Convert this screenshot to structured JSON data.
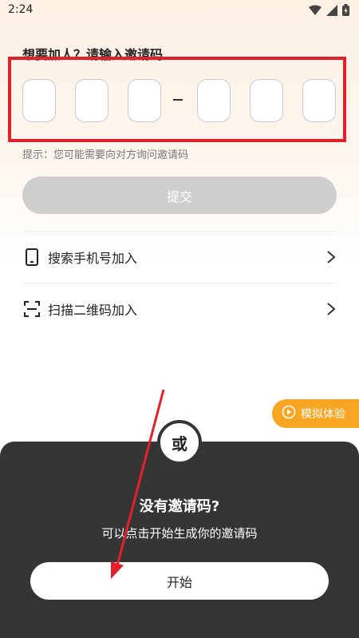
{
  "status_bar": {
    "time": "2:24",
    "icons": [
      "wifi-icon",
      "signal-icon",
      "battery-icon"
    ]
  },
  "invite": {
    "title": "想要加人？请输入邀请码",
    "code_boxes": [
      "",
      "",
      "",
      "",
      "",
      ""
    ],
    "dash": "–",
    "hint": "提示：您可能需要向对方询问邀请码",
    "submit_label": "提交"
  },
  "options": [
    {
      "label": "搜索手机号加入",
      "icon": "phone-icon"
    },
    {
      "label": "扫描二维码加入",
      "icon": "scan-icon"
    }
  ],
  "trial": {
    "label": "模拟体验",
    "icon": "play-icon"
  },
  "bottom": {
    "or_label": "或",
    "title": "没有邀请码?",
    "description": "可以点击开始生成你的邀请码",
    "start_label": "开始"
  },
  "colors": {
    "accent_orange": "#f7a523",
    "highlight_red": "#e5202b",
    "panel_dark": "#353535",
    "submit_disabled": "#cfcfcf"
  }
}
